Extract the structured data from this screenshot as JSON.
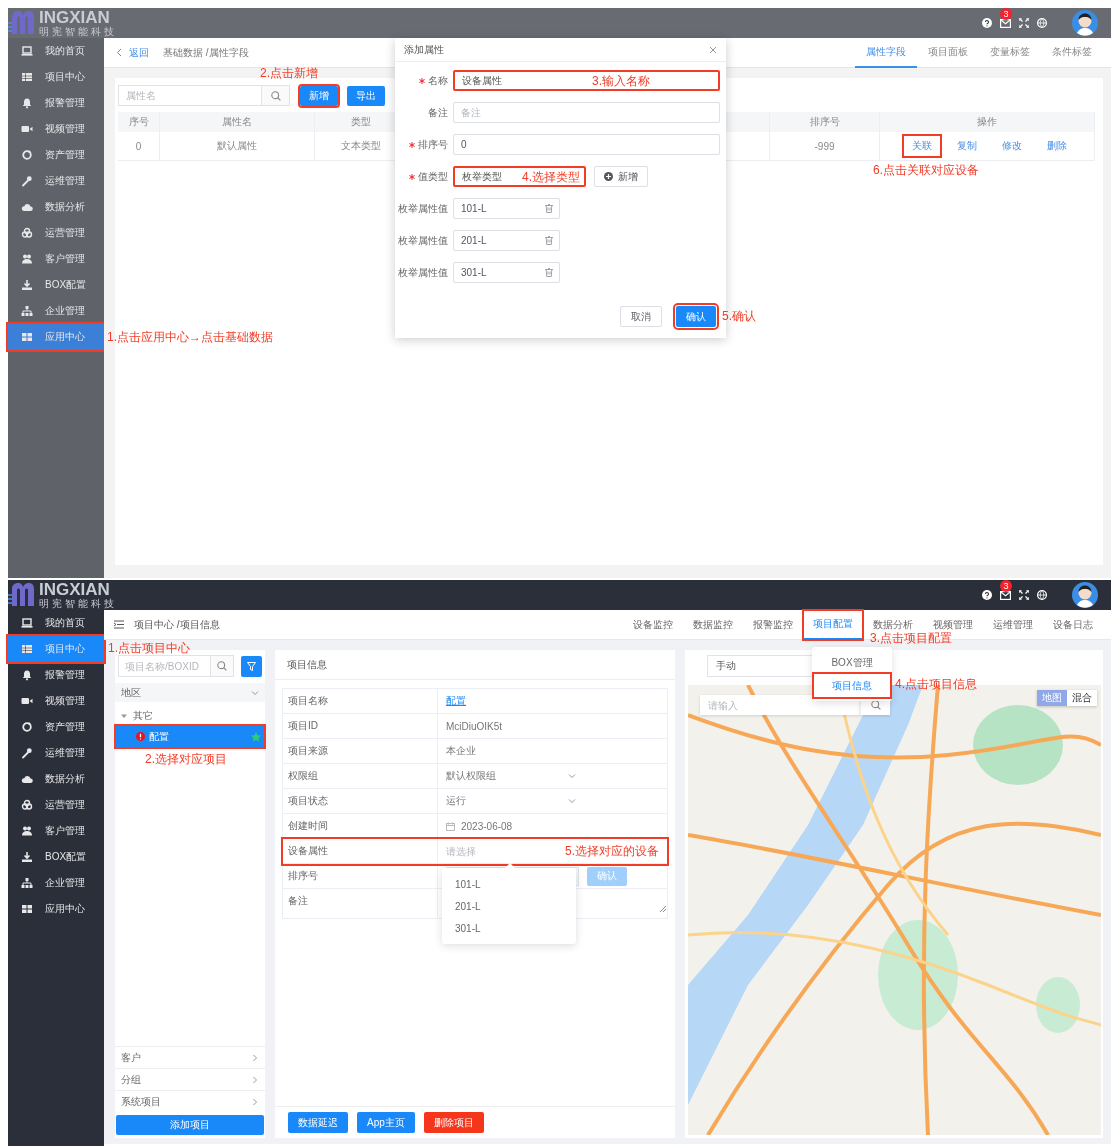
{
  "screen_1": {
    "logo": {
      "wordmark": "INGXIAN",
      "tagline": "明宪智能科技"
    },
    "notification_count": "3",
    "sidebar": {
      "items": [
        {
          "label": "我的首页",
          "selected": false,
          "highlighted": false
        },
        {
          "label": "项目中心",
          "selected": false,
          "highlighted": false
        },
        {
          "label": "报警管理",
          "selected": false,
          "highlighted": false
        },
        {
          "label": "视频管理",
          "selected": false,
          "highlighted": false
        },
        {
          "label": "资产管理",
          "selected": false,
          "highlighted": false
        },
        {
          "label": "运维管理",
          "selected": false,
          "highlighted": false
        },
        {
          "label": "数据分析",
          "selected": false,
          "highlighted": false
        },
        {
          "label": "运营管理",
          "selected": false,
          "highlighted": false
        },
        {
          "label": "客户管理",
          "selected": false,
          "highlighted": false
        },
        {
          "label": "BOX配置",
          "selected": false,
          "highlighted": false
        },
        {
          "label": "企业管理",
          "selected": false,
          "highlighted": false
        },
        {
          "label": "应用中心",
          "selected": true,
          "highlighted": true
        }
      ]
    },
    "sidebar_note": "1.点击应用中心→点击基础数据",
    "breadcrumb": {
      "back": "返回",
      "path": "基础数据 /属性字段"
    },
    "tabs": [
      {
        "label": "属性字段",
        "selected": true
      },
      {
        "label": "项目面板",
        "selected": false
      },
      {
        "label": "变量标签",
        "selected": false
      },
      {
        "label": "条件标签",
        "selected": false
      }
    ],
    "search": {
      "placeholder": "属性名"
    },
    "buttons": [
      {
        "label": "新增",
        "highlighted": true
      },
      {
        "label": "导出",
        "highlighted": false
      }
    ],
    "add_note": "2.点击新增",
    "table": {
      "columns": [
        "序号",
        "属性名",
        "类型",
        "排序号",
        "操作"
      ],
      "rows": [
        {
          "cells": [
            "0",
            "默认属性",
            "文本类型",
            "-999"
          ],
          "actions": [
            {
              "label": "关联",
              "highlighted": true
            },
            {
              "label": "复制",
              "highlighted": false
            },
            {
              "label": "修改",
              "highlighted": false
            },
            {
              "label": "删除",
              "highlighted": false
            }
          ]
        }
      ]
    },
    "action_note": "6.点击关联对应设备",
    "dialog": {
      "title": "添加属性",
      "fields": [
        {
          "label": "名称",
          "required": true,
          "value": "设备属性",
          "highlighted": true,
          "note": "3.输入名称"
        },
        {
          "label": "备注",
          "required": false,
          "placeholder": "备注",
          "highlighted": false
        },
        {
          "label": "排序号",
          "required": true,
          "value": "0",
          "highlighted": false
        },
        {
          "label": "值类型",
          "required": true,
          "value": "枚举类型",
          "highlighted": true,
          "note": "4.选择类型"
        }
      ],
      "add_button": "新增",
      "enum_values": [
        {
          "label": "枚举属性值",
          "value": "101-L"
        },
        {
          "label": "枚举属性值",
          "value": "201-L"
        },
        {
          "label": "枚举属性值",
          "value": "301-L"
        }
      ],
      "buttons": [
        {
          "label": "取消",
          "kind": "plain",
          "highlighted": false
        },
        {
          "label": "确认",
          "kind": "primary",
          "highlighted": true
        }
      ],
      "confirm_note": "5.确认"
    }
  },
  "screen_2": {
    "logo": {
      "wordmark": "INGXIAN",
      "tagline": "明宪智能科技"
    },
    "notification_count": "3",
    "sidebar": {
      "items": [
        {
          "label": "我的首页",
          "selected": false,
          "highlighted": false
        },
        {
          "label": "项目中心",
          "selected": true,
          "highlighted": true
        },
        {
          "label": "报警管理",
          "selected": false,
          "highlighted": false
        },
        {
          "label": "视频管理",
          "selected": false,
          "highlighted": false
        },
        {
          "label": "资产管理",
          "selected": false,
          "highlighted": false
        },
        {
          "label": "运维管理",
          "selected": false,
          "highlighted": false
        },
        {
          "label": "数据分析",
          "selected": false,
          "highlighted": false
        },
        {
          "label": "运营管理",
          "selected": false,
          "highlighted": false
        },
        {
          "label": "客户管理",
          "selected": false,
          "highlighted": false
        },
        {
          "label": "BOX配置",
          "selected": false,
          "highlighted": false
        },
        {
          "label": "企业管理",
          "selected": false,
          "highlighted": false
        },
        {
          "label": "应用中心",
          "selected": false,
          "highlighted": false
        }
      ]
    },
    "sidebar_note": "1.点击项目中心",
    "breadcrumb": "项目中心 /项目信息",
    "nav": [
      {
        "label": "设备监控",
        "selected": false,
        "highlighted": false
      },
      {
        "label": "数据监控",
        "selected": false,
        "highlighted": false
      },
      {
        "label": "报警监控",
        "selected": false,
        "highlighted": false
      },
      {
        "label": "项目配置",
        "selected": true,
        "highlighted": true
      },
      {
        "label": "数据分析",
        "selected": false,
        "highlighted": false
      },
      {
        "label": "视频管理",
        "selected": false,
        "highlighted": false
      },
      {
        "label": "运维管理",
        "selected": false,
        "highlighted": false
      },
      {
        "label": "设备日志",
        "selected": false,
        "highlighted": false
      }
    ],
    "nav_note": "3.点击项目配置",
    "nav_menu": {
      "items": [
        {
          "label": "BOX管理",
          "selected": false,
          "highlighted": false
        },
        {
          "label": "项目信息",
          "selected": true,
          "highlighted": true
        }
      ],
      "note": "4.点击项目信息"
    },
    "project_list": {
      "search": {
        "placeholder": "项目名称/BOXID"
      },
      "region": {
        "label": "地区",
        "expanded": true
      },
      "tree": [
        {
          "label": "其它",
          "expanded": true,
          "children": [
            {
              "label": "配置",
              "selected": true,
              "highlighted": true,
              "alert": true,
              "starred": true
            }
          ]
        }
      ],
      "note": "2.选择对应项目",
      "groups": [
        {
          "label": "客户",
          "expanded": false
        },
        {
          "label": "分组",
          "expanded": false
        },
        {
          "label": "系统项目",
          "expanded": false
        }
      ],
      "add_button": "添加项目"
    },
    "project_info": {
      "title": "项目信息",
      "rows": [
        {
          "label": "项目名称",
          "kind": "link",
          "value": "配置",
          "highlighted": false
        },
        {
          "label": "项目ID",
          "kind": "text",
          "value": "MciDiuOIK5t",
          "highlighted": false
        },
        {
          "label": "项目来源",
          "kind": "text",
          "value": "本企业",
          "highlighted": false
        },
        {
          "label": "权限组",
          "kind": "select",
          "value": "默认权限组",
          "highlighted": false
        },
        {
          "label": "项目状态",
          "kind": "select",
          "value": "运行",
          "highlighted": false
        },
        {
          "label": "创建时间",
          "kind": "date",
          "value": "2023-06-08",
          "highlighted": false
        },
        {
          "label": "设备属性",
          "kind": "picker",
          "placeholder": "请选择",
          "highlighted": true,
          "note": "5.选择对应的设备"
        },
        {
          "label": "排序号",
          "kind": "number",
          "button": "确认",
          "highlighted": false
        },
        {
          "label": "备注",
          "kind": "textarea",
          "highlighted": false
        }
      ],
      "dropdown": [
        "101-L",
        "201-L",
        "301-L"
      ],
      "buttons": [
        {
          "label": "数据延迟",
          "kind": "primary"
        },
        {
          "label": "App主页",
          "kind": "primary"
        },
        {
          "label": "删除项目",
          "kind": "danger"
        }
      ]
    },
    "map_panel": {
      "mode_select": {
        "value": "手动"
      },
      "search": {
        "placeholder": "请输入"
      },
      "map_types": [
        {
          "label": "地图",
          "selected": true
        },
        {
          "label": "混合",
          "selected": false
        }
      ]
    }
  }
}
